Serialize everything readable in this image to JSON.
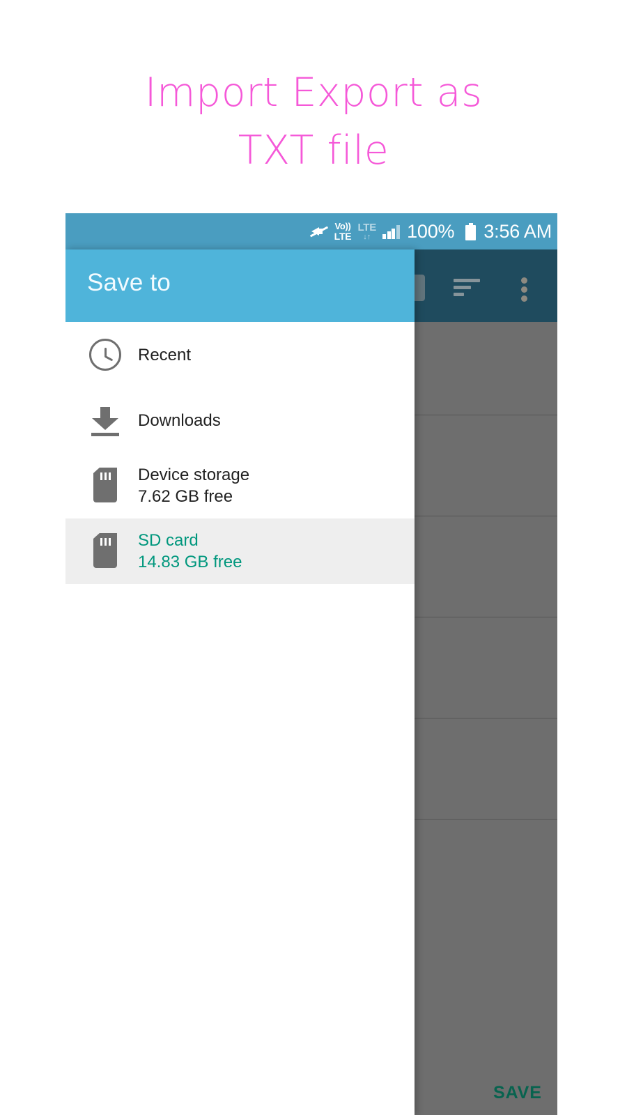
{
  "heading": "Import Export as\nTXT file",
  "colors": {
    "heading_pink": "#f558d8",
    "header_blue": "#4fb4da",
    "statusbar_blue": "#4a9dc0",
    "selected_teal": "#00977d",
    "save_green": "#08634f",
    "behind_toolbar": "#1f4b5e",
    "scrim_gray": "#6e6e6e"
  },
  "statusbar": {
    "mute_icon": "mute-speaker-icon",
    "volte_line1": "Vo))",
    "volte_line2": "LTE",
    "lte_line1": "LTE",
    "lte_line2": "↓↑",
    "signal_icon": "signal-bars-icon",
    "battery_percent": "100%",
    "battery_icon": "battery-full-icon",
    "time": "3:56 AM"
  },
  "drawer": {
    "title": "Save to",
    "items": [
      {
        "icon": "clock-icon",
        "title": "Recent",
        "subtitle": "",
        "selected": false
      },
      {
        "icon": "download-icon",
        "title": "Downloads",
        "subtitle": "",
        "selected": false
      },
      {
        "icon": "sd-card-icon",
        "title": "Device storage",
        "subtitle": "7.62 GB free",
        "selected": false
      },
      {
        "icon": "sd-card-icon",
        "title": "SD card",
        "subtitle": "14.83 GB free",
        "selected": true
      }
    ]
  },
  "behind_app": {
    "sort_icon": "sort-lines-icon",
    "overflow_icon": "overflow-menu-icon",
    "search_icon": "search-icon",
    "save_label": "SAVE"
  }
}
